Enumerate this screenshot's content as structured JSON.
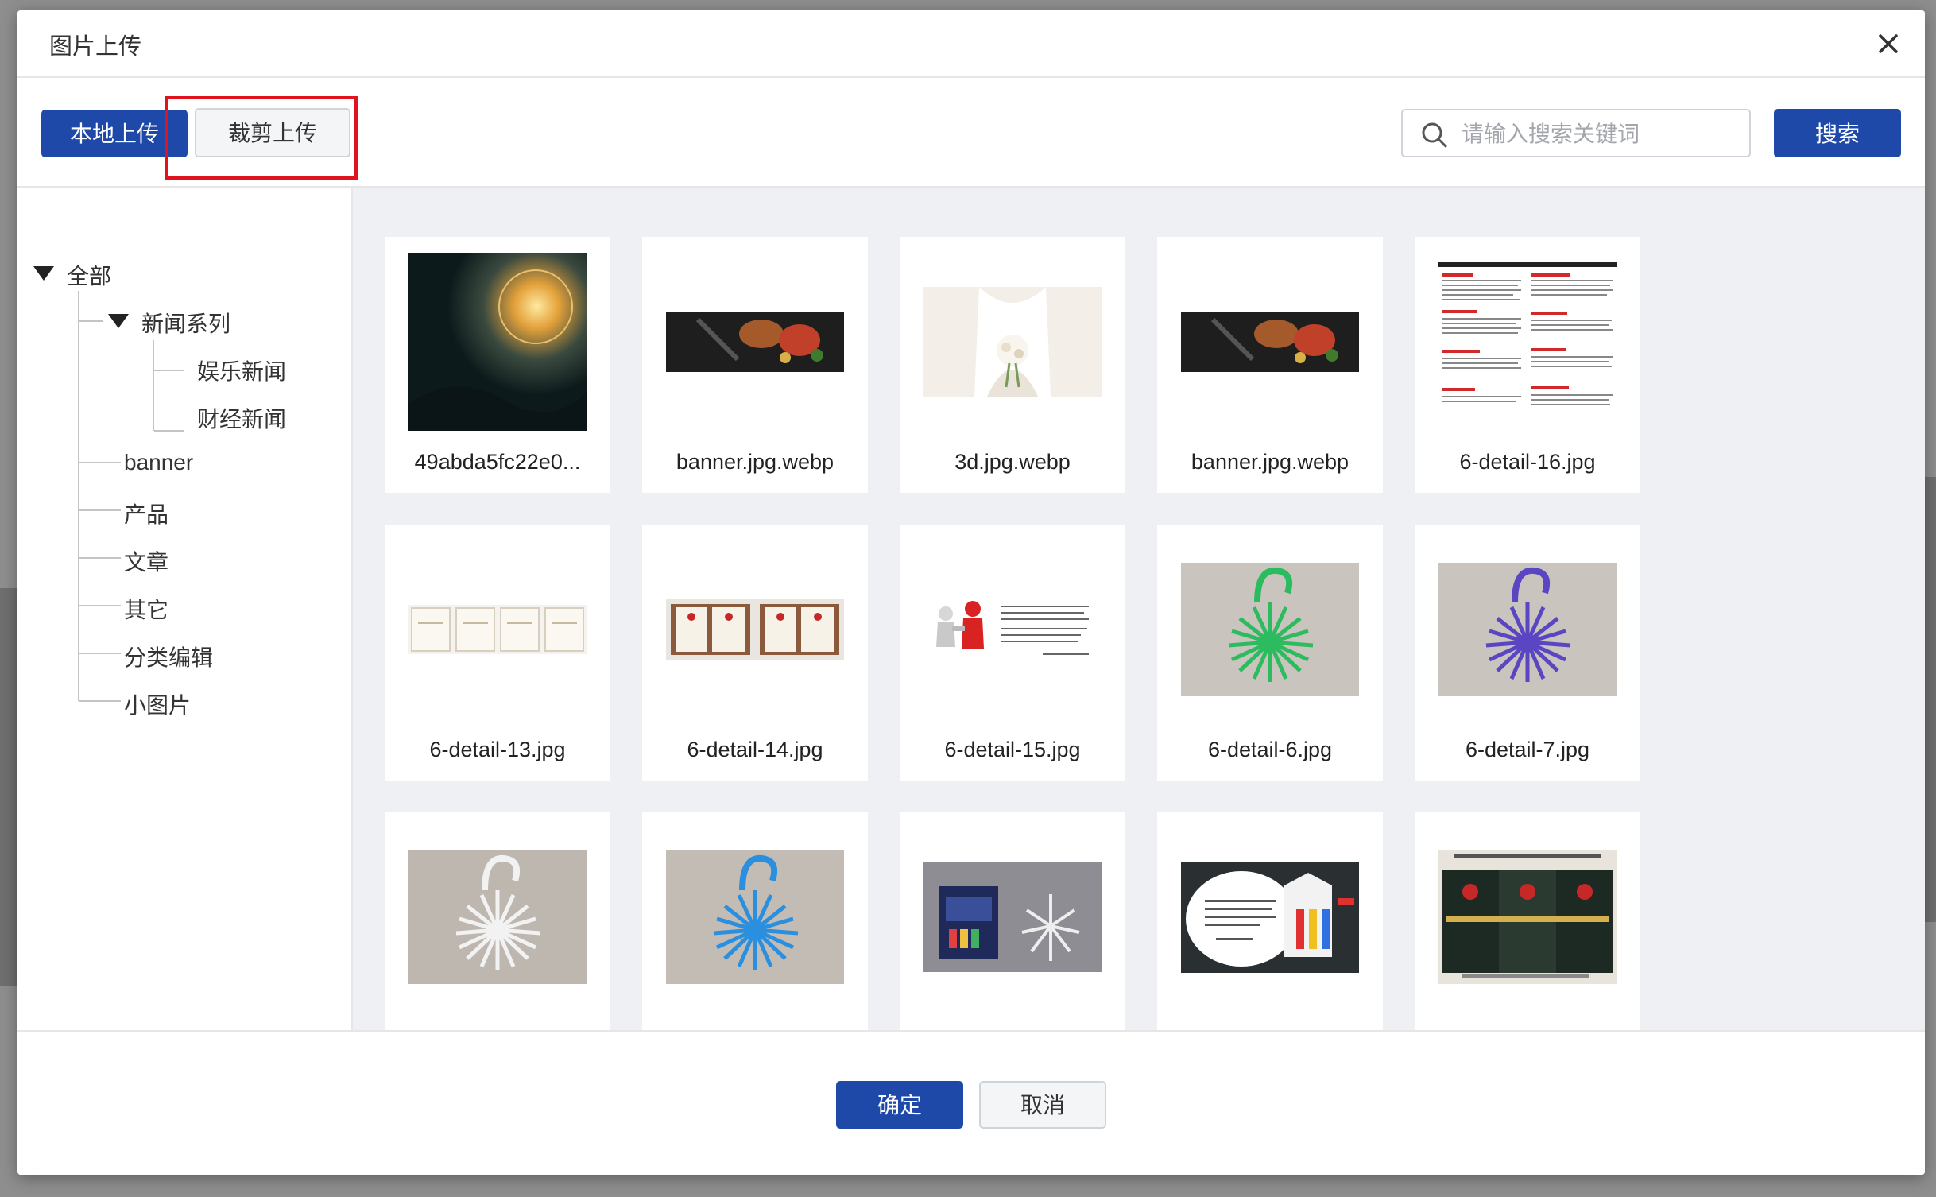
{
  "dialog": {
    "title": "图片上传"
  },
  "toolbar": {
    "local_upload_label": "本地上传",
    "crop_upload_label": "裁剪上传",
    "search_placeholder": "请输入搜索关键词",
    "search_label": "搜索"
  },
  "tree": {
    "root": "全部",
    "news_series": "新闻系列",
    "entertainment_news": "娱乐新闻",
    "finance_news": "财经新闻",
    "banner": "banner",
    "products": "产品",
    "articles": "文章",
    "others": "其它",
    "category_edit": "分类编辑",
    "small_images": "小图片"
  },
  "images": [
    {
      "name": "49abda5fc22e0...",
      "thumb": "dark-fantasy-scene"
    },
    {
      "name": "banner.jpg.webp",
      "thumb": "food-grill-banner"
    },
    {
      "name": "3d.jpg.webp",
      "thumb": "bride-bouquet"
    },
    {
      "name": "banner.jpg.webp",
      "thumb": "food-grill-banner"
    },
    {
      "name": "6-detail-16.jpg",
      "thumb": "text-document"
    },
    {
      "name": "6-detail-13.jpg",
      "thumb": "certificates-row"
    },
    {
      "name": "6-detail-14.jpg",
      "thumb": "certificates-pair"
    },
    {
      "name": "6-detail-15.jpg",
      "thumb": "handshake-figures"
    },
    {
      "name": "6-detail-6.jpg",
      "thumb": "green-hanger"
    },
    {
      "name": "6-detail-7.jpg",
      "thumb": "purple-hanger"
    },
    {
      "name": "",
      "thumb": "white-hanger"
    },
    {
      "name": "",
      "thumb": "blue-hanger"
    },
    {
      "name": "",
      "thumb": "packaged-hanger"
    },
    {
      "name": "",
      "thumb": "hanger-label"
    },
    {
      "name": "",
      "thumb": "patent-certificates"
    }
  ],
  "footer": {
    "ok_label": "确定",
    "cancel_label": "取消"
  },
  "colors": {
    "primary": "#1f49a8",
    "highlight": "#e0141e",
    "grid_bg": "#eef0f4"
  }
}
